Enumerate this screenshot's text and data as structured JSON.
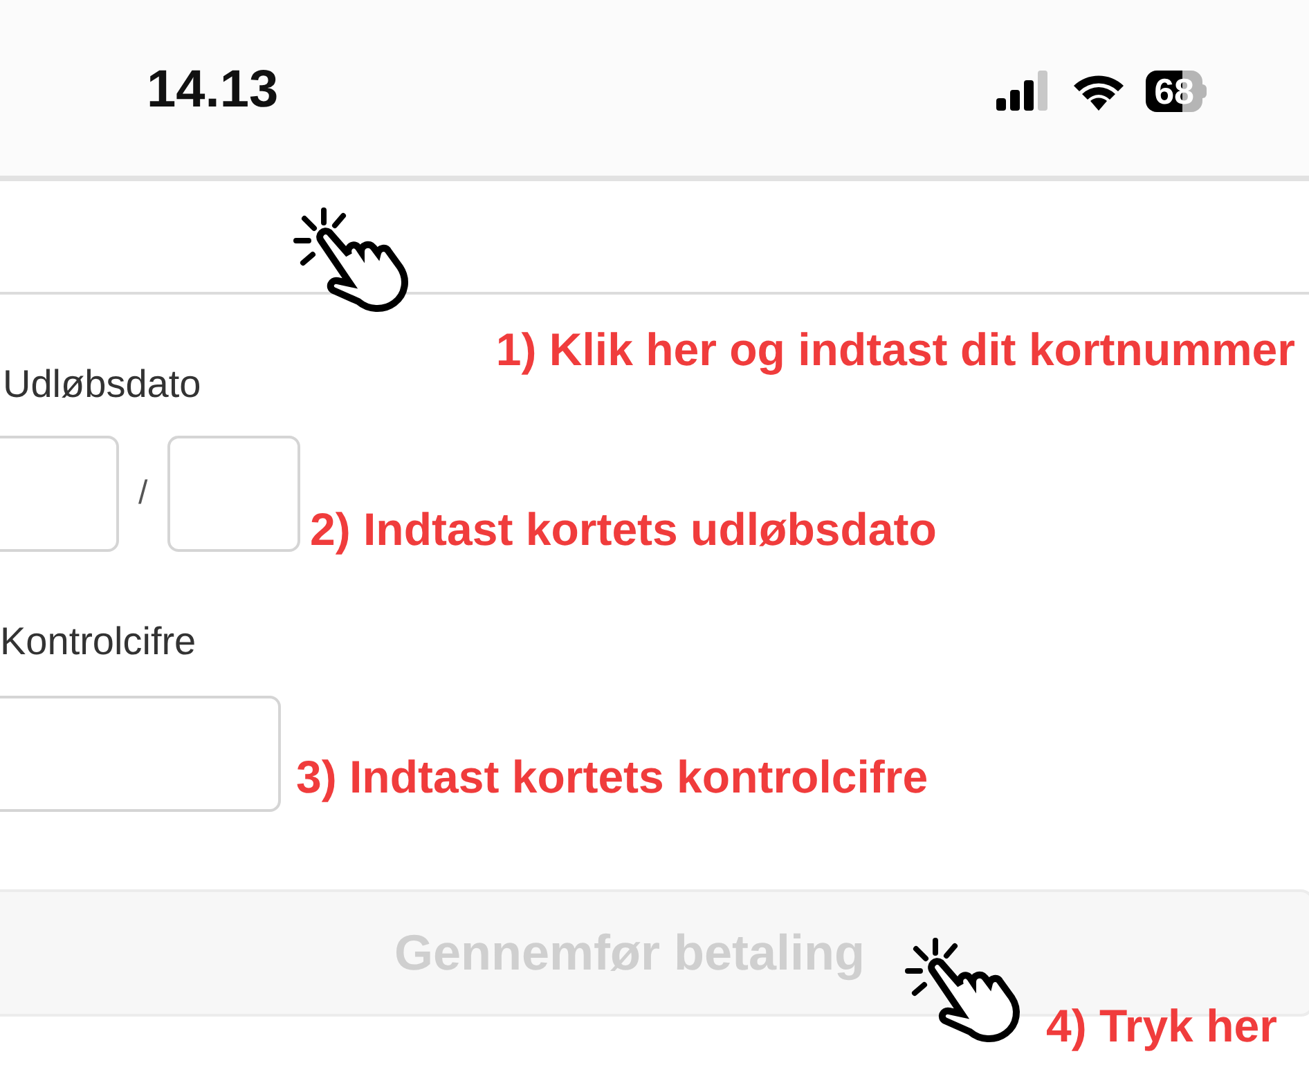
{
  "status_bar": {
    "time": "14.13",
    "battery": "68"
  },
  "expiry": {
    "label": "Udløbsdato",
    "separator": "/"
  },
  "cvc": {
    "label": "Kontrolcifre"
  },
  "pay_button": {
    "label": "Gennemfør betaling",
    "disabled": true
  },
  "annotations": [
    {
      "text": "1) Klik her og indtast dit kortnummer"
    },
    {
      "text": "2) Indtast kortets udløbsdato"
    },
    {
      "text": "3) Indtast kortets kontrolcifre"
    },
    {
      "text": "4) Tryk her"
    }
  ]
}
